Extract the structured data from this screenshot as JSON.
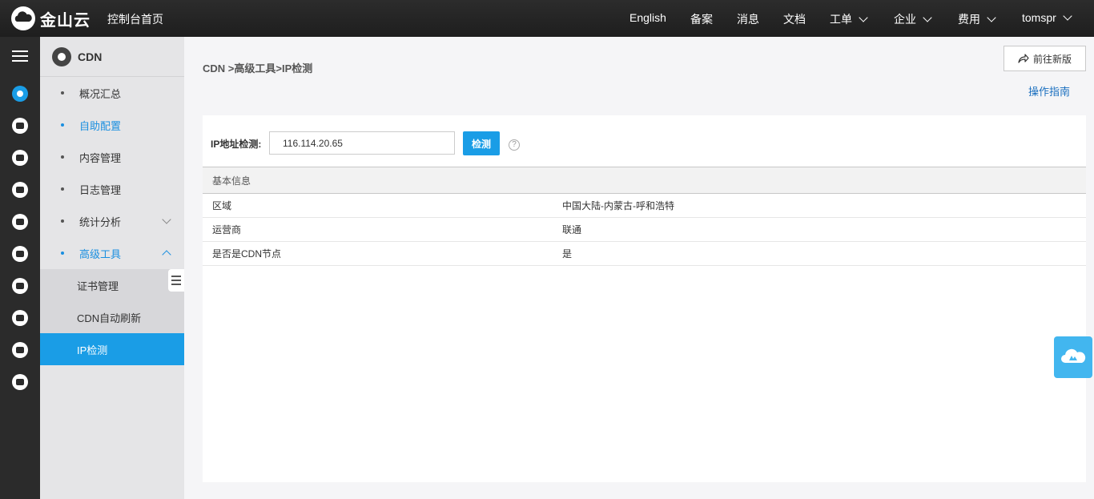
{
  "topbar": {
    "brand": "金山云",
    "home": "控制台首页",
    "nav": [
      {
        "label": "English",
        "has_dropdown": false
      },
      {
        "label": "备案",
        "has_dropdown": false
      },
      {
        "label": "消息",
        "has_dropdown": false
      },
      {
        "label": "文档",
        "has_dropdown": false
      },
      {
        "label": "工单",
        "has_dropdown": true
      },
      {
        "label": "企业",
        "has_dropdown": true
      },
      {
        "label": "费用",
        "has_dropdown": true
      },
      {
        "label": "tomspr",
        "has_dropdown": true
      }
    ]
  },
  "rail": {
    "icons": [
      "menu-icon",
      "cdn-icon",
      "server-icon",
      "app-icon",
      "network-icon",
      "cloud-storage-icon",
      "database-icon",
      "layers-icon",
      "cloud-upload-icon",
      "mail-icon",
      "id-card-icon"
    ],
    "active": "cdn-icon"
  },
  "sidebar": {
    "title": "CDN",
    "items": [
      {
        "label": "概况汇总"
      },
      {
        "label": "自助配置"
      },
      {
        "label": "内容管理"
      },
      {
        "label": "日志管理"
      },
      {
        "label": "统计分析"
      },
      {
        "label": "高级工具"
      }
    ],
    "subitems": [
      {
        "label": "证书管理"
      },
      {
        "label": "CDN自动刷新"
      },
      {
        "label": "IP检测"
      }
    ]
  },
  "main": {
    "breadcrumb": "CDN >高级工具>IP检测",
    "new_version_button": "前往新版",
    "guide_link": "操作指南",
    "form": {
      "label": "IP地址检测:",
      "ip_value": "116.114.20.65",
      "check_button": "检测",
      "help": "?"
    },
    "info": {
      "header": "基本信息",
      "rows": [
        {
          "key": "区域",
          "value": "中国大陆-内蒙古-呼和浩特"
        },
        {
          "key": "运营商",
          "value": "联通"
        },
        {
          "key": "是否是CDN节点",
          "value": "是"
        }
      ]
    }
  },
  "colors": {
    "accent": "#1a9de6",
    "topbar": "#232323",
    "rail": "#2b2b2b"
  }
}
